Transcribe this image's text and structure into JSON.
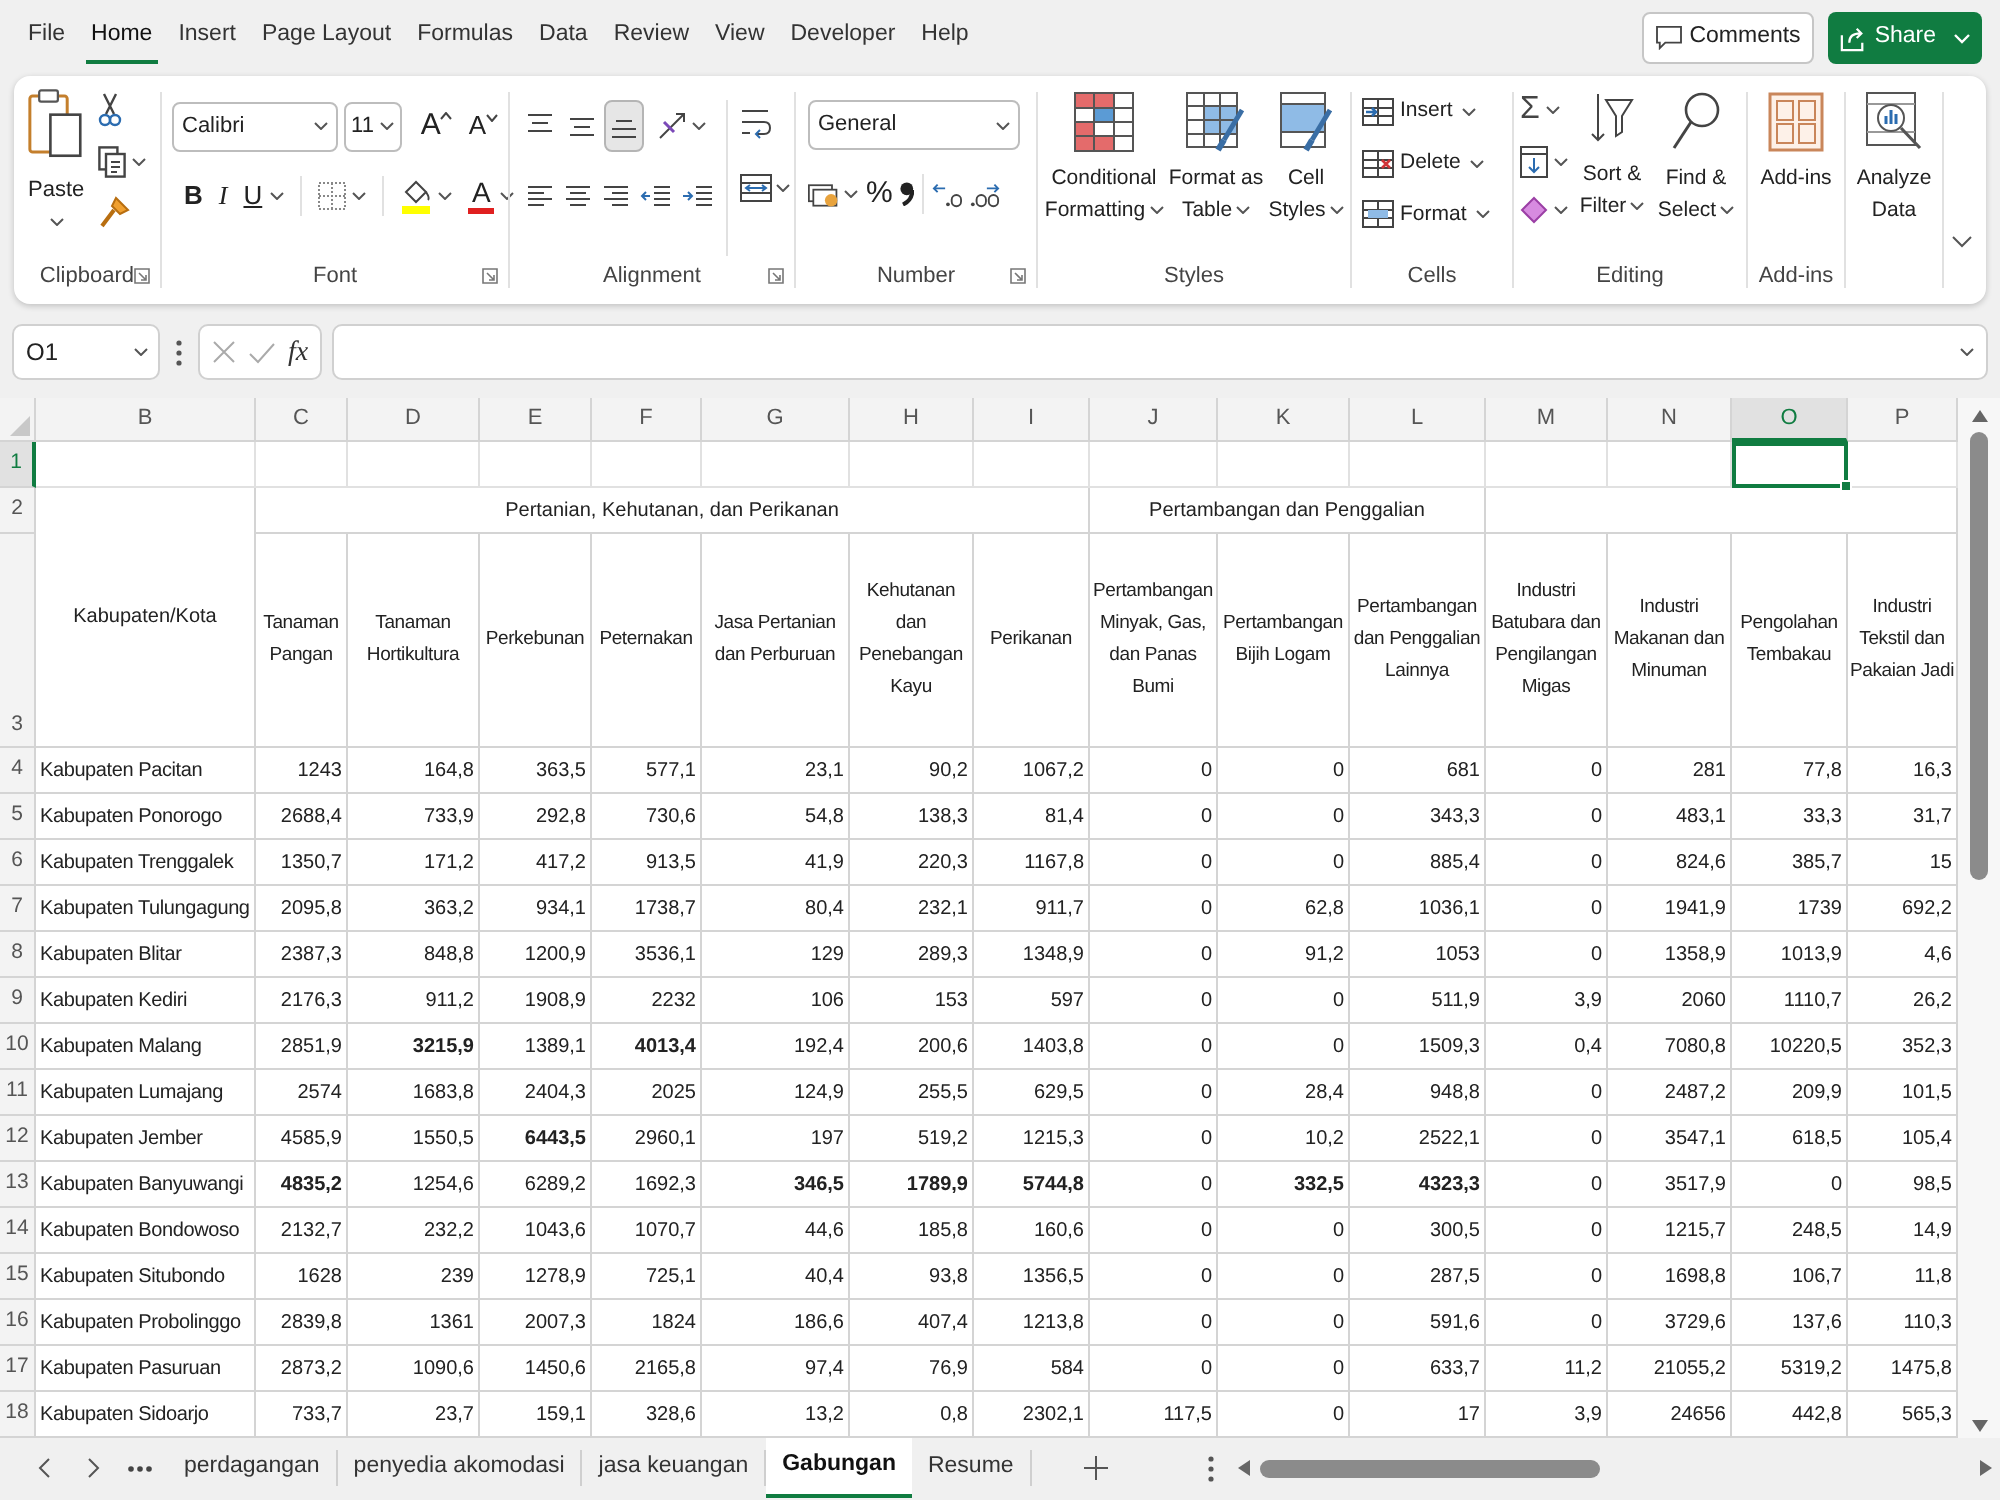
{
  "menu_tabs": [
    {
      "label": "File",
      "selected": false
    },
    {
      "label": "Home",
      "selected": true
    },
    {
      "label": "Insert",
      "selected": false
    },
    {
      "label": "Page Layout",
      "selected": false
    },
    {
      "label": "Formulas",
      "selected": false
    },
    {
      "label": "Data",
      "selected": false
    },
    {
      "label": "Review",
      "selected": false
    },
    {
      "label": "View",
      "selected": false
    },
    {
      "label": "Developer",
      "selected": false
    },
    {
      "label": "Help",
      "selected": false
    }
  ],
  "header_buttons": {
    "comments": "Comments",
    "share": "Share"
  },
  "ribbon": {
    "clipboard": {
      "label": "Clipboard",
      "paste": "Paste"
    },
    "font": {
      "label": "Font",
      "font_name": "Calibri",
      "font_size": "11",
      "size_buttons": [
        "A",
        "A"
      ],
      "style_buttons": [
        "B",
        "I",
        "U"
      ],
      "font_color": "A"
    },
    "alignment": {
      "label": "Alignment",
      "vertical_align": [
        {
          "selected": false
        },
        {
          "selected": false
        },
        {
          "selected": true
        }
      ]
    },
    "number": {
      "label": "Number",
      "format": "General",
      "percent": "%"
    },
    "styles": {
      "label": "Styles",
      "buttons": [
        "Conditional Formatting",
        "Format as Table",
        "Cell Styles"
      ]
    },
    "cells": {
      "label": "Cells",
      "buttons": [
        "Insert",
        "Delete",
        "Format"
      ]
    },
    "editing": {
      "label": "Editing",
      "autosum": "Σ",
      "buttons": [
        "Sort & Filter",
        "Find & Select"
      ]
    },
    "add_ins": {
      "label": "Add-ins",
      "button": "Add-ins"
    },
    "analyze_data": {
      "button": "Analyze Data"
    }
  },
  "formula_bar": {
    "name_box": "O1",
    "function_label": "fx"
  },
  "sheet": {
    "column_letters": [
      {
        "label": "B",
        "selected": false
      },
      {
        "label": "C",
        "selected": false
      },
      {
        "label": "D",
        "selected": false
      },
      {
        "label": "E",
        "selected": false
      },
      {
        "label": "F",
        "selected": false
      },
      {
        "label": "G",
        "selected": false
      },
      {
        "label": "H",
        "selected": false
      },
      {
        "label": "I",
        "selected": false
      },
      {
        "label": "J",
        "selected": false
      },
      {
        "label": "K",
        "selected": false
      },
      {
        "label": "L",
        "selected": false
      },
      {
        "label": "M",
        "selected": false
      },
      {
        "label": "N",
        "selected": false
      },
      {
        "label": "O",
        "selected": true
      },
      {
        "label": "P",
        "selected": false
      }
    ],
    "header_rows": [
      {
        "number": "1",
        "selected": true
      },
      {
        "number": "2",
        "selected": false
      },
      {
        "number": "3",
        "selected": false
      }
    ],
    "row_label_header": "Kabupaten/Kota",
    "groups": [
      {
        "label": "Pertanian, Kehutanan, dan Perikanan",
        "fields": [
          "Tanaman Pangan",
          "Tanaman Hortikultura",
          "Perkebunan",
          "Peternakan",
          "Jasa Pertanian dan Perburuan",
          "Kehutanan dan Penebangan Kayu",
          "Perikanan"
        ]
      },
      {
        "label": "Pertambangan dan Penggalian",
        "fields": [
          "Pertambangan Minyak, Gas, dan Panas Bumi",
          "Pertambangan Bijih Logam",
          "Pertambangan dan Penggalian Lainnya"
        ]
      },
      {
        "fields": [
          "Industri Batubara dan Pengilangan Migas",
          "Industri Makanan dan Minuman",
          "Pengolahan Tembakau",
          "Industri Tekstil dan Pakaian Jadi"
        ]
      }
    ],
    "rows": [
      {
        "number": "4",
        "selected": false,
        "name": "Kabupaten Pacitan",
        "values": [
          "1243",
          "164,8",
          "363,5",
          "577,1",
          "23,1",
          "90,2",
          "1067,2",
          "0",
          "0",
          "681",
          "0",
          "281",
          "77,8",
          "16,3"
        ],
        "bold": [
          false,
          false,
          false,
          false,
          false,
          false,
          false,
          false,
          false,
          false,
          false,
          false,
          false,
          false
        ]
      },
      {
        "number": "5",
        "selected": false,
        "name": "Kabupaten Ponorogo",
        "values": [
          "2688,4",
          "733,9",
          "292,8",
          "730,6",
          "54,8",
          "138,3",
          "81,4",
          "0",
          "0",
          "343,3",
          "0",
          "483,1",
          "33,3",
          "31,7"
        ],
        "bold": [
          false,
          false,
          false,
          false,
          false,
          false,
          false,
          false,
          false,
          false,
          false,
          false,
          false,
          false
        ]
      },
      {
        "number": "6",
        "selected": false,
        "name": "Kabupaten Trenggalek",
        "values": [
          "1350,7",
          "171,2",
          "417,2",
          "913,5",
          "41,9",
          "220,3",
          "1167,8",
          "0",
          "0",
          "885,4",
          "0",
          "824,6",
          "385,7",
          "15"
        ],
        "bold": [
          false,
          false,
          false,
          false,
          false,
          false,
          false,
          false,
          false,
          false,
          false,
          false,
          false,
          false
        ]
      },
      {
        "number": "7",
        "selected": false,
        "name": "Kabupaten Tulungagung",
        "values": [
          "2095,8",
          "363,2",
          "934,1",
          "1738,7",
          "80,4",
          "232,1",
          "911,7",
          "0",
          "62,8",
          "1036,1",
          "0",
          "1941,9",
          "1739",
          "692,2"
        ],
        "bold": [
          false,
          false,
          false,
          false,
          false,
          false,
          false,
          false,
          false,
          false,
          false,
          false,
          false,
          false
        ]
      },
      {
        "number": "8",
        "selected": false,
        "name": "Kabupaten Blitar",
        "values": [
          "2387,3",
          "848,8",
          "1200,9",
          "3536,1",
          "129",
          "289,3",
          "1348,9",
          "0",
          "91,2",
          "1053",
          "0",
          "1358,9",
          "1013,9",
          "4,6"
        ],
        "bold": [
          false,
          false,
          false,
          false,
          false,
          false,
          false,
          false,
          false,
          false,
          false,
          false,
          false,
          false
        ]
      },
      {
        "number": "9",
        "selected": false,
        "name": "Kabupaten Kediri",
        "values": [
          "2176,3",
          "911,2",
          "1908,9",
          "2232",
          "106",
          "153",
          "597",
          "0",
          "0",
          "511,9",
          "3,9",
          "2060",
          "1110,7",
          "26,2"
        ],
        "bold": [
          false,
          false,
          false,
          false,
          false,
          false,
          false,
          false,
          false,
          false,
          false,
          false,
          false,
          false
        ]
      },
      {
        "number": "10",
        "selected": false,
        "name": "Kabupaten Malang",
        "values": [
          "2851,9",
          "3215,9",
          "1389,1",
          "4013,4",
          "192,4",
          "200,6",
          "1403,8",
          "0",
          "0",
          "1509,3",
          "0,4",
          "7080,8",
          "10220,5",
          "352,3"
        ],
        "bold": [
          false,
          true,
          false,
          true,
          false,
          false,
          false,
          false,
          false,
          false,
          false,
          false,
          false,
          false
        ]
      },
      {
        "number": "11",
        "selected": false,
        "name": "Kabupaten Lumajang",
        "values": [
          "2574",
          "1683,8",
          "2404,3",
          "2025",
          "124,9",
          "255,5",
          "629,5",
          "0",
          "28,4",
          "948,8",
          "0",
          "2487,2",
          "209,9",
          "101,5"
        ],
        "bold": [
          false,
          false,
          false,
          false,
          false,
          false,
          false,
          false,
          false,
          false,
          false,
          false,
          false,
          false
        ]
      },
      {
        "number": "12",
        "selected": false,
        "name": "Kabupaten Jember",
        "values": [
          "4585,9",
          "1550,5",
          "6443,5",
          "2960,1",
          "197",
          "519,2",
          "1215,3",
          "0",
          "10,2",
          "2522,1",
          "0",
          "3547,1",
          "618,5",
          "105,4"
        ],
        "bold": [
          false,
          false,
          true,
          false,
          false,
          false,
          false,
          false,
          false,
          false,
          false,
          false,
          false,
          false
        ]
      },
      {
        "number": "13",
        "selected": false,
        "name": "Kabupaten Banyuwangi",
        "values": [
          "4835,2",
          "1254,6",
          "6289,2",
          "1692,3",
          "346,5",
          "1789,9",
          "5744,8",
          "0",
          "332,5",
          "4323,3",
          "0",
          "3517,9",
          "0",
          "98,5"
        ],
        "bold": [
          true,
          false,
          false,
          false,
          true,
          true,
          true,
          false,
          true,
          true,
          false,
          false,
          false,
          false
        ]
      },
      {
        "number": "14",
        "selected": false,
        "name": "Kabupaten Bondowoso",
        "values": [
          "2132,7",
          "232,2",
          "1043,6",
          "1070,7",
          "44,6",
          "185,8",
          "160,6",
          "0",
          "0",
          "300,5",
          "0",
          "1215,7",
          "248,5",
          "14,9"
        ],
        "bold": [
          false,
          false,
          false,
          false,
          false,
          false,
          false,
          false,
          false,
          false,
          false,
          false,
          false,
          false
        ]
      },
      {
        "number": "15",
        "selected": false,
        "name": "Kabupaten Situbondo",
        "values": [
          "1628",
          "239",
          "1278,9",
          "725,1",
          "40,4",
          "93,8",
          "1356,5",
          "0",
          "0",
          "287,5",
          "0",
          "1698,8",
          "106,7",
          "11,8"
        ],
        "bold": [
          false,
          false,
          false,
          false,
          false,
          false,
          false,
          false,
          false,
          false,
          false,
          false,
          false,
          false
        ]
      },
      {
        "number": "16",
        "selected": false,
        "name": "Kabupaten Probolinggo",
        "values": [
          "2839,8",
          "1361",
          "2007,3",
          "1824",
          "186,6",
          "407,4",
          "1213,8",
          "0",
          "0",
          "591,6",
          "0",
          "3729,6",
          "137,6",
          "110,3"
        ],
        "bold": [
          false,
          false,
          false,
          false,
          false,
          false,
          false,
          false,
          false,
          false,
          false,
          false,
          false,
          false
        ]
      },
      {
        "number": "17",
        "selected": false,
        "name": "Kabupaten Pasuruan",
        "values": [
          "2873,2",
          "1090,6",
          "1450,6",
          "2165,8",
          "97,4",
          "76,9",
          "584",
          "0",
          "0",
          "633,7",
          "11,2",
          "21055,2",
          "5319,2",
          "1475,8"
        ],
        "bold": [
          false,
          false,
          false,
          false,
          false,
          false,
          false,
          false,
          false,
          false,
          false,
          false,
          false,
          false
        ]
      },
      {
        "number": "18",
        "selected": false,
        "name": "Kabupaten Sidoarjo",
        "values": [
          "733,7",
          "23,7",
          "159,1",
          "328,6",
          "13,2",
          "0,8",
          "2302,1",
          "117,5",
          "0",
          "17",
          "3,9",
          "24656",
          "442,8",
          "565,3"
        ],
        "bold": [
          false,
          false,
          false,
          false,
          false,
          false,
          false,
          false,
          false,
          false,
          false,
          false,
          false,
          false
        ]
      }
    ]
  },
  "sheet_tabs": [
    {
      "label": "perdagangan",
      "selected": false
    },
    {
      "label": "penyedia akomodasi",
      "selected": false
    },
    {
      "label": "jasa keuangan",
      "selected": false
    },
    {
      "label": "Gabungan",
      "selected": true
    },
    {
      "label": "Resume",
      "selected": false
    }
  ]
}
